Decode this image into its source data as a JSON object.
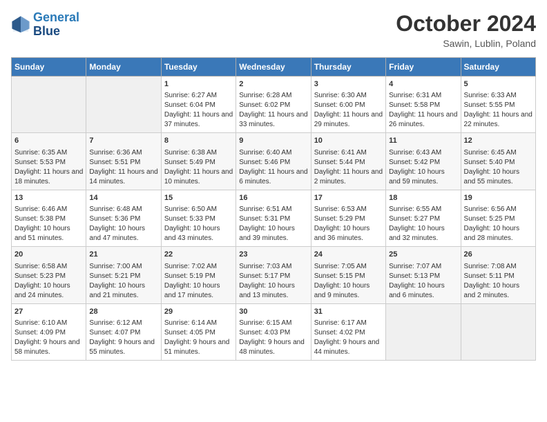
{
  "header": {
    "logo_line1": "General",
    "logo_line2": "Blue",
    "month_title": "October 2024",
    "location": "Sawin, Lublin, Poland"
  },
  "weekdays": [
    "Sunday",
    "Monday",
    "Tuesday",
    "Wednesday",
    "Thursday",
    "Friday",
    "Saturday"
  ],
  "weeks": [
    [
      {
        "day": "",
        "empty": true
      },
      {
        "day": "",
        "empty": true
      },
      {
        "day": "1",
        "sunrise": "Sunrise: 6:27 AM",
        "sunset": "Sunset: 6:04 PM",
        "daylight": "Daylight: 11 hours and 37 minutes."
      },
      {
        "day": "2",
        "sunrise": "Sunrise: 6:28 AM",
        "sunset": "Sunset: 6:02 PM",
        "daylight": "Daylight: 11 hours and 33 minutes."
      },
      {
        "day": "3",
        "sunrise": "Sunrise: 6:30 AM",
        "sunset": "Sunset: 6:00 PM",
        "daylight": "Daylight: 11 hours and 29 minutes."
      },
      {
        "day": "4",
        "sunrise": "Sunrise: 6:31 AM",
        "sunset": "Sunset: 5:58 PM",
        "daylight": "Daylight: 11 hours and 26 minutes."
      },
      {
        "day": "5",
        "sunrise": "Sunrise: 6:33 AM",
        "sunset": "Sunset: 5:55 PM",
        "daylight": "Daylight: 11 hours and 22 minutes."
      }
    ],
    [
      {
        "day": "6",
        "sunrise": "Sunrise: 6:35 AM",
        "sunset": "Sunset: 5:53 PM",
        "daylight": "Daylight: 11 hours and 18 minutes."
      },
      {
        "day": "7",
        "sunrise": "Sunrise: 6:36 AM",
        "sunset": "Sunset: 5:51 PM",
        "daylight": "Daylight: 11 hours and 14 minutes."
      },
      {
        "day": "8",
        "sunrise": "Sunrise: 6:38 AM",
        "sunset": "Sunset: 5:49 PM",
        "daylight": "Daylight: 11 hours and 10 minutes."
      },
      {
        "day": "9",
        "sunrise": "Sunrise: 6:40 AM",
        "sunset": "Sunset: 5:46 PM",
        "daylight": "Daylight: 11 hours and 6 minutes."
      },
      {
        "day": "10",
        "sunrise": "Sunrise: 6:41 AM",
        "sunset": "Sunset: 5:44 PM",
        "daylight": "Daylight: 11 hours and 2 minutes."
      },
      {
        "day": "11",
        "sunrise": "Sunrise: 6:43 AM",
        "sunset": "Sunset: 5:42 PM",
        "daylight": "Daylight: 10 hours and 59 minutes."
      },
      {
        "day": "12",
        "sunrise": "Sunrise: 6:45 AM",
        "sunset": "Sunset: 5:40 PM",
        "daylight": "Daylight: 10 hours and 55 minutes."
      }
    ],
    [
      {
        "day": "13",
        "sunrise": "Sunrise: 6:46 AM",
        "sunset": "Sunset: 5:38 PM",
        "daylight": "Daylight: 10 hours and 51 minutes."
      },
      {
        "day": "14",
        "sunrise": "Sunrise: 6:48 AM",
        "sunset": "Sunset: 5:36 PM",
        "daylight": "Daylight: 10 hours and 47 minutes."
      },
      {
        "day": "15",
        "sunrise": "Sunrise: 6:50 AM",
        "sunset": "Sunset: 5:33 PM",
        "daylight": "Daylight: 10 hours and 43 minutes."
      },
      {
        "day": "16",
        "sunrise": "Sunrise: 6:51 AM",
        "sunset": "Sunset: 5:31 PM",
        "daylight": "Daylight: 10 hours and 39 minutes."
      },
      {
        "day": "17",
        "sunrise": "Sunrise: 6:53 AM",
        "sunset": "Sunset: 5:29 PM",
        "daylight": "Daylight: 10 hours and 36 minutes."
      },
      {
        "day": "18",
        "sunrise": "Sunrise: 6:55 AM",
        "sunset": "Sunset: 5:27 PM",
        "daylight": "Daylight: 10 hours and 32 minutes."
      },
      {
        "day": "19",
        "sunrise": "Sunrise: 6:56 AM",
        "sunset": "Sunset: 5:25 PM",
        "daylight": "Daylight: 10 hours and 28 minutes."
      }
    ],
    [
      {
        "day": "20",
        "sunrise": "Sunrise: 6:58 AM",
        "sunset": "Sunset: 5:23 PM",
        "daylight": "Daylight: 10 hours and 24 minutes."
      },
      {
        "day": "21",
        "sunrise": "Sunrise: 7:00 AM",
        "sunset": "Sunset: 5:21 PM",
        "daylight": "Daylight: 10 hours and 21 minutes."
      },
      {
        "day": "22",
        "sunrise": "Sunrise: 7:02 AM",
        "sunset": "Sunset: 5:19 PM",
        "daylight": "Daylight: 10 hours and 17 minutes."
      },
      {
        "day": "23",
        "sunrise": "Sunrise: 7:03 AM",
        "sunset": "Sunset: 5:17 PM",
        "daylight": "Daylight: 10 hours and 13 minutes."
      },
      {
        "day": "24",
        "sunrise": "Sunrise: 7:05 AM",
        "sunset": "Sunset: 5:15 PM",
        "daylight": "Daylight: 10 hours and 9 minutes."
      },
      {
        "day": "25",
        "sunrise": "Sunrise: 7:07 AM",
        "sunset": "Sunset: 5:13 PM",
        "daylight": "Daylight: 10 hours and 6 minutes."
      },
      {
        "day": "26",
        "sunrise": "Sunrise: 7:08 AM",
        "sunset": "Sunset: 5:11 PM",
        "daylight": "Daylight: 10 hours and 2 minutes."
      }
    ],
    [
      {
        "day": "27",
        "sunrise": "Sunrise: 6:10 AM",
        "sunset": "Sunset: 4:09 PM",
        "daylight": "Daylight: 9 hours and 58 minutes."
      },
      {
        "day": "28",
        "sunrise": "Sunrise: 6:12 AM",
        "sunset": "Sunset: 4:07 PM",
        "daylight": "Daylight: 9 hours and 55 minutes."
      },
      {
        "day": "29",
        "sunrise": "Sunrise: 6:14 AM",
        "sunset": "Sunset: 4:05 PM",
        "daylight": "Daylight: 9 hours and 51 minutes."
      },
      {
        "day": "30",
        "sunrise": "Sunrise: 6:15 AM",
        "sunset": "Sunset: 4:03 PM",
        "daylight": "Daylight: 9 hours and 48 minutes."
      },
      {
        "day": "31",
        "sunrise": "Sunrise: 6:17 AM",
        "sunset": "Sunset: 4:02 PM",
        "daylight": "Daylight: 9 hours and 44 minutes."
      },
      {
        "day": "",
        "empty": true
      },
      {
        "day": "",
        "empty": true
      }
    ]
  ]
}
